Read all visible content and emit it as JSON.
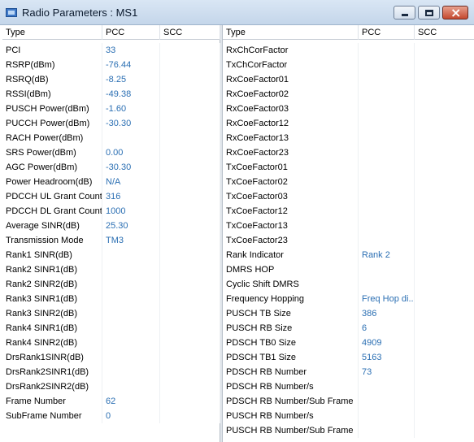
{
  "window": {
    "title": "Radio Parameters : MS1"
  },
  "columns": {
    "type": "Type",
    "pcc": "PCC",
    "scc": "SCC"
  },
  "left_rows": [
    {
      "type": "PCI",
      "pcc": "33",
      "scc": ""
    },
    {
      "type": "RSRP(dBm)",
      "pcc": "-76.44",
      "scc": ""
    },
    {
      "type": "RSRQ(dB)",
      "pcc": "-8.25",
      "scc": ""
    },
    {
      "type": "RSSI(dBm)",
      "pcc": "-49.38",
      "scc": ""
    },
    {
      "type": "PUSCH Power(dBm)",
      "pcc": "-1.60",
      "scc": ""
    },
    {
      "type": "PUCCH Power(dBm)",
      "pcc": "-30.30",
      "scc": ""
    },
    {
      "type": "RACH Power(dBm)",
      "pcc": "",
      "scc": ""
    },
    {
      "type": "SRS Power(dBm)",
      "pcc": "0.00",
      "scc": ""
    },
    {
      "type": "AGC Power(dBm)",
      "pcc": "-30.30",
      "scc": ""
    },
    {
      "type": "Power Headroom(dB)",
      "pcc": "N/A",
      "scc": ""
    },
    {
      "type": "PDCCH UL Grant Count",
      "pcc": "316",
      "scc": ""
    },
    {
      "type": "PDCCH DL Grant Count",
      "pcc": "1000",
      "scc": ""
    },
    {
      "type": "Average SINR(dB)",
      "pcc": "25.30",
      "scc": ""
    },
    {
      "type": "Transmission Mode",
      "pcc": "TM3",
      "scc": ""
    },
    {
      "type": "Rank1 SINR(dB)",
      "pcc": "",
      "scc": ""
    },
    {
      "type": "Rank2 SINR1(dB)",
      "pcc": "",
      "scc": ""
    },
    {
      "type": "Rank2 SINR2(dB)",
      "pcc": "",
      "scc": ""
    },
    {
      "type": "Rank3 SINR1(dB)",
      "pcc": "",
      "scc": ""
    },
    {
      "type": "Rank3 SINR2(dB)",
      "pcc": "",
      "scc": ""
    },
    {
      "type": "Rank4 SINR1(dB)",
      "pcc": "",
      "scc": ""
    },
    {
      "type": "Rank4 SINR2(dB)",
      "pcc": "",
      "scc": ""
    },
    {
      "type": "DrsRank1SINR(dB)",
      "pcc": "",
      "scc": ""
    },
    {
      "type": "DrsRank2SINR1(dB)",
      "pcc": "",
      "scc": ""
    },
    {
      "type": "DrsRank2SINR2(dB)",
      "pcc": "",
      "scc": ""
    },
    {
      "type": "Frame Number",
      "pcc": "62",
      "scc": ""
    },
    {
      "type": "SubFrame Number",
      "pcc": "0",
      "scc": ""
    }
  ],
  "right_rows": [
    {
      "type": "RxChCorFactor",
      "pcc": "",
      "scc": ""
    },
    {
      "type": "TxChCorFactor",
      "pcc": "",
      "scc": ""
    },
    {
      "type": "RxCoeFactor01",
      "pcc": "",
      "scc": ""
    },
    {
      "type": "RxCoeFactor02",
      "pcc": "",
      "scc": ""
    },
    {
      "type": "RxCoeFactor03",
      "pcc": "",
      "scc": ""
    },
    {
      "type": "RxCoeFactor12",
      "pcc": "",
      "scc": ""
    },
    {
      "type": "RxCoeFactor13",
      "pcc": "",
      "scc": ""
    },
    {
      "type": "RxCoeFactor23",
      "pcc": "",
      "scc": ""
    },
    {
      "type": "TxCoeFactor01",
      "pcc": "",
      "scc": ""
    },
    {
      "type": "TxCoeFactor02",
      "pcc": "",
      "scc": ""
    },
    {
      "type": "TxCoeFactor03",
      "pcc": "",
      "scc": ""
    },
    {
      "type": "TxCoeFactor12",
      "pcc": "",
      "scc": ""
    },
    {
      "type": "TxCoeFactor13",
      "pcc": "",
      "scc": ""
    },
    {
      "type": "TxCoeFactor23",
      "pcc": "",
      "scc": ""
    },
    {
      "type": "Rank Indicator",
      "pcc": "Rank 2",
      "scc": ""
    },
    {
      "type": "DMRS HOP",
      "pcc": "",
      "scc": ""
    },
    {
      "type": "Cyclic Shift DMRS",
      "pcc": "",
      "scc": ""
    },
    {
      "type": "Frequency Hopping",
      "pcc": "Freq Hop di...",
      "scc": ""
    },
    {
      "type": "PUSCH TB Size",
      "pcc": "386",
      "scc": ""
    },
    {
      "type": "PUSCH RB Size",
      "pcc": "6",
      "scc": ""
    },
    {
      "type": "PDSCH TB0 Size",
      "pcc": "4909",
      "scc": ""
    },
    {
      "type": "PDSCH TB1 Size",
      "pcc": "5163",
      "scc": ""
    },
    {
      "type": "PDSCH RB Number",
      "pcc": "73",
      "scc": ""
    },
    {
      "type": "PDSCH RB Number/s",
      "pcc": "",
      "scc": ""
    },
    {
      "type": "PDSCH RB Number/Sub Frame",
      "pcc": "",
      "scc": ""
    },
    {
      "type": "PUSCH RB Number/s",
      "pcc": "",
      "scc": ""
    },
    {
      "type": "PUSCH RB Number/Sub Frame",
      "pcc": "",
      "scc": ""
    }
  ],
  "colors": {
    "value": "#2b6fb3",
    "titlebar": "#c4d6ea"
  },
  "icons": {
    "app": "app-window-icon",
    "minimize": "minimize-icon",
    "maximize": "maximize-icon",
    "close": "close-icon"
  }
}
